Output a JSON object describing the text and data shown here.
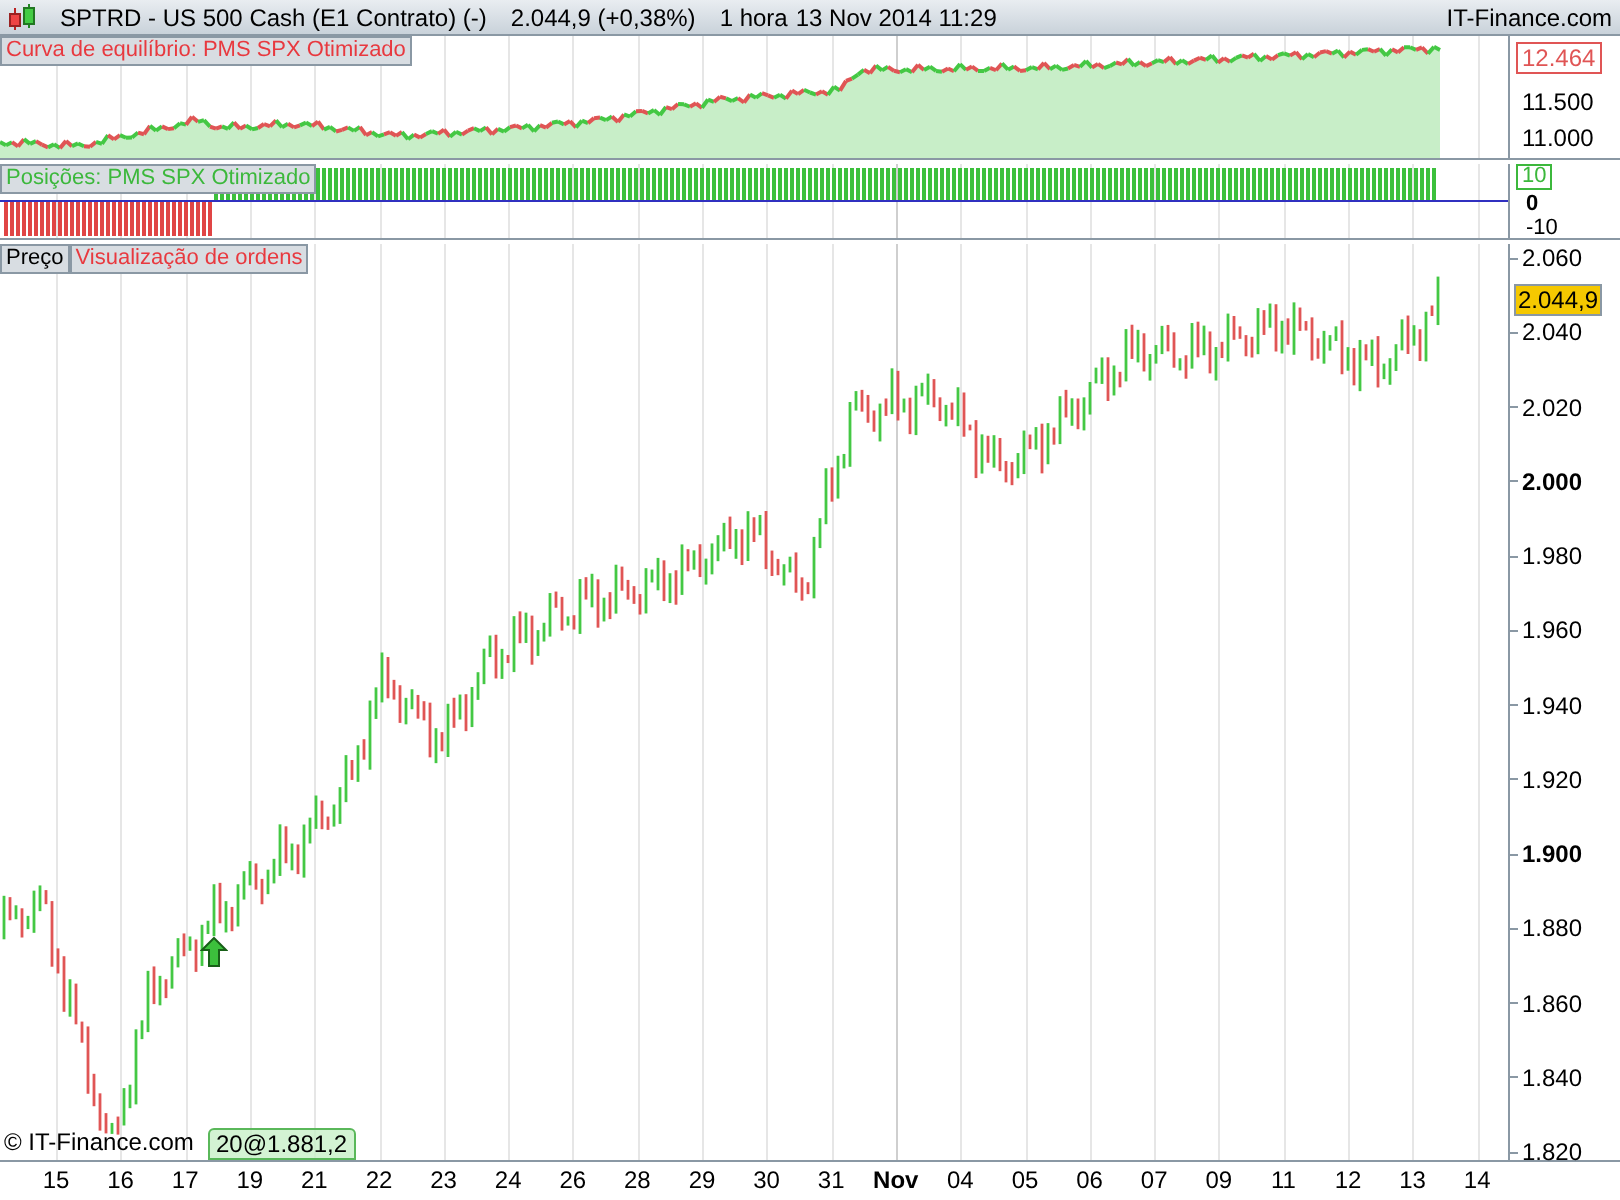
{
  "header": {
    "symbol": "SPTRD - US 500 Cash (E1 Contrato) (-)",
    "price": "2.044,9 (+0,38%)",
    "interval": "1 hora",
    "datetime": "13 Nov 2014 11:29",
    "brand": "IT-Finance.com"
  },
  "equity_panel": {
    "legend": [
      {
        "text": "Curva de equilíbrio: PMS SPX Otimizado",
        "color": "#e8393f"
      }
    ],
    "badge": "12.464",
    "axis_labels": [
      "11.500",
      "11.000"
    ]
  },
  "positions_panel": {
    "legend": [
      {
        "text": "Posições: PMS SPX Otimizado",
        "color": "#3cb83c"
      }
    ],
    "badge": "10",
    "axis_labels": [
      {
        "text": "0",
        "bold": true
      },
      {
        "text": "-10",
        "bold": false
      }
    ]
  },
  "price_panel": {
    "legend": [
      {
        "text": "Preço",
        "color": "#000000"
      },
      {
        "text": "Visualização de ordens",
        "color": "#e8393f"
      }
    ],
    "badge": "2.044,9",
    "axis_labels": [
      {
        "text": "2.060",
        "bold": false
      },
      {
        "text": "2.040",
        "bold": false
      },
      {
        "text": "2.020",
        "bold": false
      },
      {
        "text": "2.000",
        "bold": true
      },
      {
        "text": "1.980",
        "bold": false
      },
      {
        "text": "1.960",
        "bold": false
      },
      {
        "text": "1.940",
        "bold": false
      },
      {
        "text": "1.920",
        "bold": false
      },
      {
        "text": "1.900",
        "bold": true
      },
      {
        "text": "1.880",
        "bold": false
      },
      {
        "text": "1.860",
        "bold": false
      },
      {
        "text": "1.840",
        "bold": false
      },
      {
        "text": "1.820",
        "bold": false
      }
    ],
    "order_label": "20@1.881,2",
    "copyright": "© IT-Finance.com"
  },
  "x_axis": [
    {
      "text": "15",
      "bold": false
    },
    {
      "text": "16",
      "bold": false
    },
    {
      "text": "17",
      "bold": false
    },
    {
      "text": "19",
      "bold": false
    },
    {
      "text": "21",
      "bold": false
    },
    {
      "text": "22",
      "bold": false
    },
    {
      "text": "23",
      "bold": false
    },
    {
      "text": "24",
      "bold": false
    },
    {
      "text": "26",
      "bold": false
    },
    {
      "text": "28",
      "bold": false
    },
    {
      "text": "29",
      "bold": false
    },
    {
      "text": "30",
      "bold": false
    },
    {
      "text": "31",
      "bold": false
    },
    {
      "text": "Nov",
      "bold": true
    },
    {
      "text": "04",
      "bold": false
    },
    {
      "text": "05",
      "bold": false
    },
    {
      "text": "06",
      "bold": false
    },
    {
      "text": "07",
      "bold": false
    },
    {
      "text": "09",
      "bold": false
    },
    {
      "text": "11",
      "bold": false
    },
    {
      "text": "12",
      "bold": false
    },
    {
      "text": "13",
      "bold": false
    },
    {
      "text": "14",
      "bold": false
    }
  ]
}
